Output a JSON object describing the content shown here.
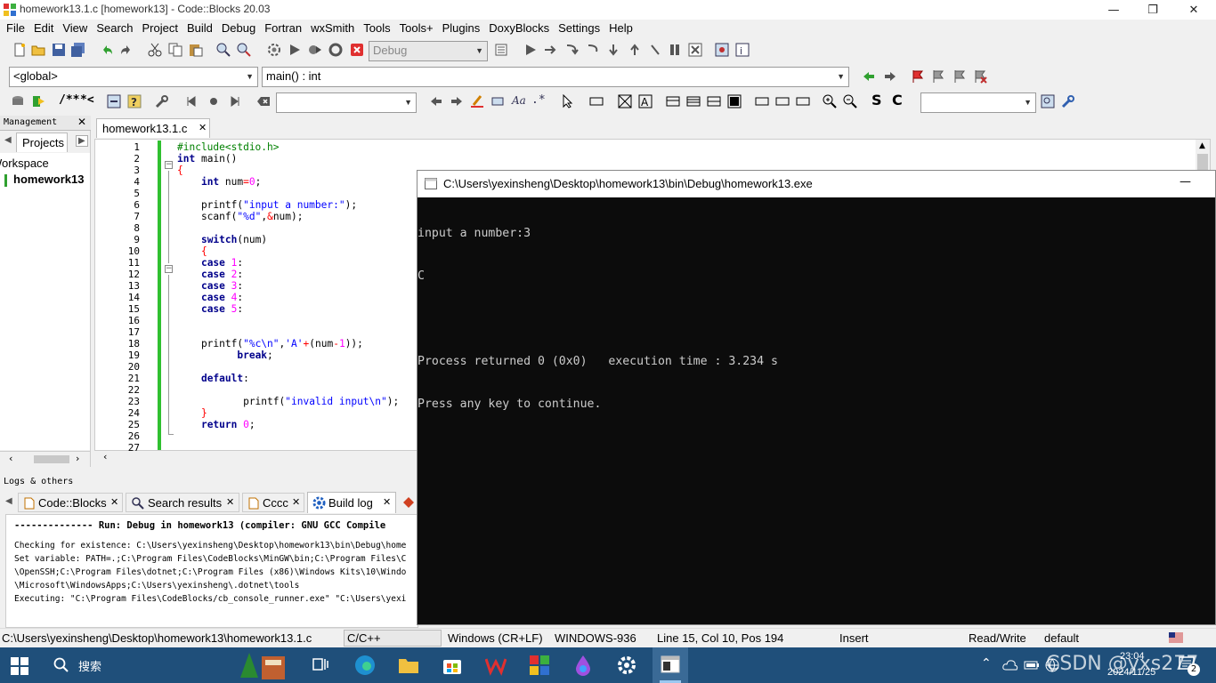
{
  "window": {
    "title": "homework13.1.c [homework13] - Code::Blocks 20.03",
    "minimize": "—",
    "maximize": "❐",
    "close": "✕"
  },
  "menu": [
    "File",
    "Edit",
    "View",
    "Search",
    "Project",
    "Build",
    "Debug",
    "Fortran",
    "wxSmith",
    "Tools",
    "Tools+",
    "Plugins",
    "DoxyBlocks",
    "Settings",
    "Help"
  ],
  "toolbar": {
    "build_target": "Debug",
    "scope": "<global>",
    "function": "main() : int",
    "search_value": "",
    "search2_value": "",
    "comment_block": "/**",
    "comment_line": "*<",
    "bold_s": "S",
    "bold_c": "C",
    "regex": ".*"
  },
  "management": {
    "title": "Management",
    "close": "✕",
    "tab_projects": "Projects",
    "workspace": "Workspace",
    "project": "homework13"
  },
  "editor": {
    "tab_label": "homework13.1.c",
    "tab_close": "✕",
    "line_numbers": [
      "1",
      "2",
      "3",
      "4",
      "5",
      "6",
      "7",
      "8",
      "9",
      "10",
      "11",
      "12",
      "13",
      "14",
      "15",
      "16",
      "17",
      "18",
      "19",
      "20",
      "21",
      "22",
      "23",
      "24",
      "25",
      "26",
      "27"
    ]
  },
  "console": {
    "title": "C:\\Users\\yexinsheng\\Desktop\\homework13\\bin\\Debug\\homework13.exe",
    "minimize": "—",
    "lines": [
      "input a number:3",
      "C",
      "",
      "Process returned 0 (0x0)   execution time : 3.234 s",
      "Press any key to continue."
    ]
  },
  "logs": {
    "title": "Logs & others",
    "tabs": [
      {
        "label": "Code::Blocks"
      },
      {
        "label": "Search results"
      },
      {
        "label": "Cccc"
      },
      {
        "label": "Build log"
      }
    ],
    "tab_close": "✕",
    "lines": [
      "-------------- Run: Debug in homework13 (compiler: GNU GCC Compile",
      "Checking for existence: C:\\Users\\yexinsheng\\Desktop\\homework13\\bin\\Debug\\home",
      "Set variable: PATH=.;C:\\Program Files\\CodeBlocks\\MinGW\\bin;C:\\Program Files\\C",
      "\\OpenSSH;C:\\Program Files\\dotnet;C:\\Program Files (x86)\\Windows Kits\\10\\Windo",
      "\\Microsoft\\WindowsApps;C:\\Users\\yexinsheng\\.dotnet\\tools",
      "Executing: \"C:\\Program Files\\CodeBlocks/cb_console_runner.exe\" \"C:\\Users\\yexi"
    ]
  },
  "status": {
    "path": "C:\\Users\\yexinsheng\\Desktop\\homework13\\homework13.1.c",
    "lang": "C/C++",
    "eol": "Windows (CR+LF)",
    "encoding": "WINDOWS-936",
    "position": "Line 15, Col 10, Pos 194",
    "mode": "Insert",
    "access": "Read/Write",
    "profile": "default"
  },
  "taskbar": {
    "search": "搜索",
    "time": "23:04",
    "date": "2024/11/25",
    "watermark": "CSDN @yxs277",
    "notif_count": "2"
  }
}
